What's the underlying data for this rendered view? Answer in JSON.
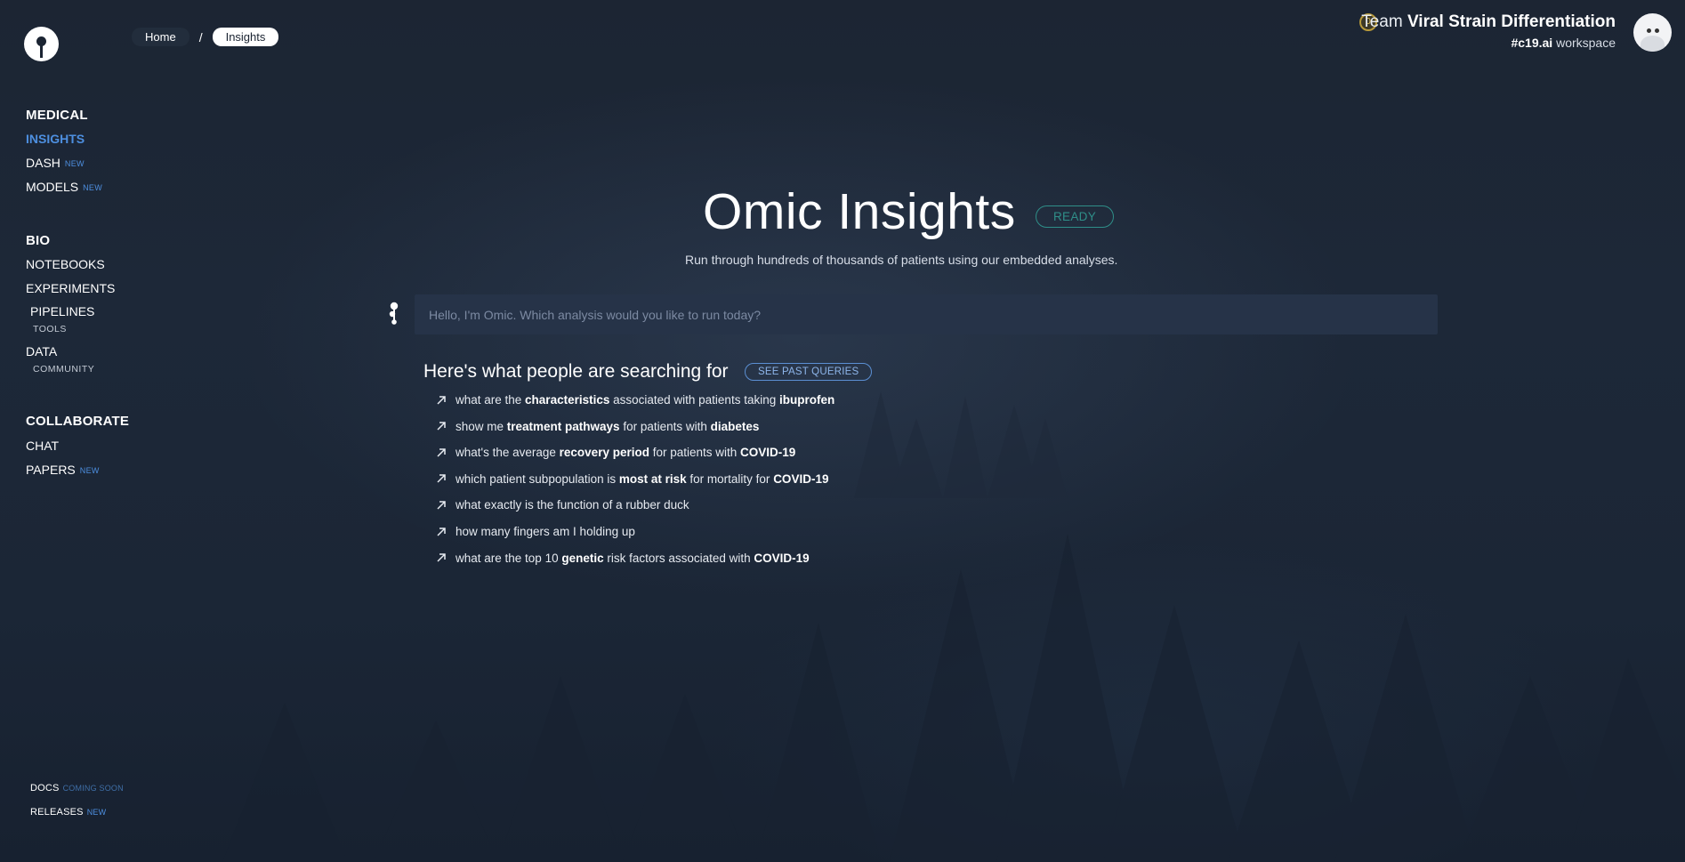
{
  "breadcrumb": {
    "home": "Home",
    "separator": "/",
    "current": "Insights"
  },
  "sidebar": {
    "medical": {
      "title": "MEDICAL",
      "items": [
        {
          "label": "INSIGHTS",
          "badge": ""
        },
        {
          "label": "DASH",
          "badge": "NEW"
        },
        {
          "label": "MODELS",
          "badge": "NEW"
        }
      ]
    },
    "bio": {
      "title": "BIO",
      "items": [
        {
          "label": "NOTEBOOKS"
        },
        {
          "label": "EXPERIMENTS"
        },
        {
          "label": "PIPELINES",
          "sub": "TOOLS"
        },
        {
          "label": "DATA",
          "sub": "COMMUNITY"
        }
      ]
    },
    "collaborate": {
      "title": "COLLABORATE",
      "items": [
        {
          "label": "CHAT",
          "badge": ""
        },
        {
          "label": "PAPERS",
          "badge": "NEW"
        }
      ]
    },
    "footer": {
      "docs": {
        "label": "DOCS",
        "badge": "COMING SOON"
      },
      "releases": {
        "label": "RELEASES",
        "badge": "NEW"
      }
    }
  },
  "team": {
    "coins": "0",
    "prefix": "Team",
    "name": "Viral Strain Differentiation",
    "workspace_handle": "#c19.ai",
    "workspace_suffix": "workspace"
  },
  "main": {
    "title": "Omic Insights",
    "status": "READY",
    "subtitle": "Run through hundreds of thousands of patients using our embedded analyses.",
    "search_placeholder": "Hello, I'm Omic. Which analysis would you like to run today?",
    "popular_title": "Here's what people are searching for",
    "past_queries_label": "SEE PAST QUERIES",
    "queries": [
      {
        "parts": [
          {
            "t": "what are the ",
            "b": false
          },
          {
            "t": "characteristics",
            "b": true
          },
          {
            "t": " associated with patients taking ",
            "b": false
          },
          {
            "t": "ibuprofen",
            "b": true
          }
        ]
      },
      {
        "parts": [
          {
            "t": "show me ",
            "b": false
          },
          {
            "t": "treatment pathways",
            "b": true
          },
          {
            "t": " for patients with ",
            "b": false
          },
          {
            "t": "diabetes",
            "b": true
          }
        ]
      },
      {
        "parts": [
          {
            "t": "what's the average ",
            "b": false
          },
          {
            "t": "recovery period",
            "b": true
          },
          {
            "t": " for patients with ",
            "b": false
          },
          {
            "t": "COVID-19",
            "b": true
          }
        ]
      },
      {
        "parts": [
          {
            "t": "which patient subpopulation is ",
            "b": false
          },
          {
            "t": "most at risk",
            "b": true
          },
          {
            "t": " for mortality for ",
            "b": false
          },
          {
            "t": "COVID-19",
            "b": true
          }
        ]
      },
      {
        "parts": [
          {
            "t": "what exactly is the function of a rubber duck",
            "b": false
          }
        ]
      },
      {
        "parts": [
          {
            "t": "how many fingers am I holding up",
            "b": false
          }
        ]
      },
      {
        "parts": [
          {
            "t": "what are the top 10 ",
            "b": false
          },
          {
            "t": "genetic",
            "b": true
          },
          {
            "t": " risk factors associated with ",
            "b": false
          },
          {
            "t": "COVID-19",
            "b": true
          }
        ]
      }
    ]
  },
  "colors": {
    "accent_blue": "#4d8fe0",
    "ready_teal": "#2f8f89",
    "search_bg": "#263348"
  },
  "icons": {
    "logo": "omic-logo-icon",
    "omic": "omic-assistant-icon",
    "query_arrow": "arrow-up-right-icon",
    "avatar": "robot-avatar"
  }
}
